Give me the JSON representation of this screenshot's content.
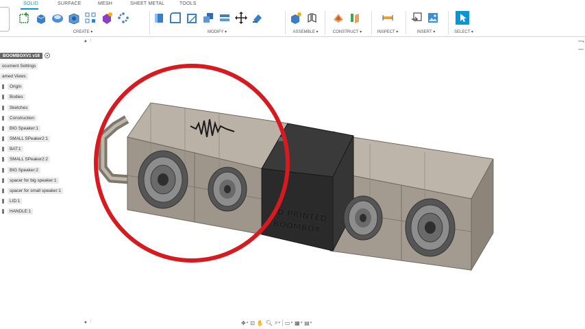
{
  "tabs": [
    {
      "label": "SOLID",
      "active": true
    },
    {
      "label": "SURFACE",
      "active": false
    },
    {
      "label": "MESH",
      "active": false
    },
    {
      "label": "SHEET METAL",
      "active": false
    },
    {
      "label": "TOOLS",
      "active": false
    }
  ],
  "groups": {
    "create": "CREATE ▾",
    "modify": "MODIFY ▾",
    "assemble": "ASSEMBLE ▾",
    "construct": "CONSTRUCT ▾",
    "inspect": "INSPECT ▾",
    "insert": "INSERT ▾",
    "select": "SELECT ▾"
  },
  "browser": {
    "root": "BOOMBOXV1 v18",
    "items": [
      "ocument Settings",
      "amed Views",
      "Origin",
      "Bodies",
      "Sketches",
      "Construction",
      "BIG Speaker:1",
      "SMALL SPeaker2:1",
      "BAT:1",
      "SMALL SPeaker2:2",
      "BIG Speaker:2",
      "spacer for big speaker:1",
      "spacer for small speaker:1",
      "LID:1",
      "HANDLE:1"
    ]
  },
  "model": {
    "engraving_line1": "3D PRINTED",
    "engraving_line2": "BOOMBOX"
  },
  "colors": {
    "accent": "#0696d7",
    "annotation_circle": "#d71920",
    "body_dark": "#2a2a2a",
    "shell": "#8a8278"
  },
  "icons": [
    "sketch-icon",
    "extrude-icon",
    "revolve-icon",
    "box-icon",
    "pattern-icon",
    "form-icon",
    "press-pull-icon",
    "fillet-icon",
    "chamfer-icon",
    "shell-icon",
    "combine-icon",
    "move-icon",
    "split-icon",
    "new-component-icon",
    "joint-icon",
    "offset-plane-icon",
    "midplane-icon",
    "measure-icon",
    "insert-icon",
    "canvas-image-icon",
    "select-cursor-icon"
  ]
}
